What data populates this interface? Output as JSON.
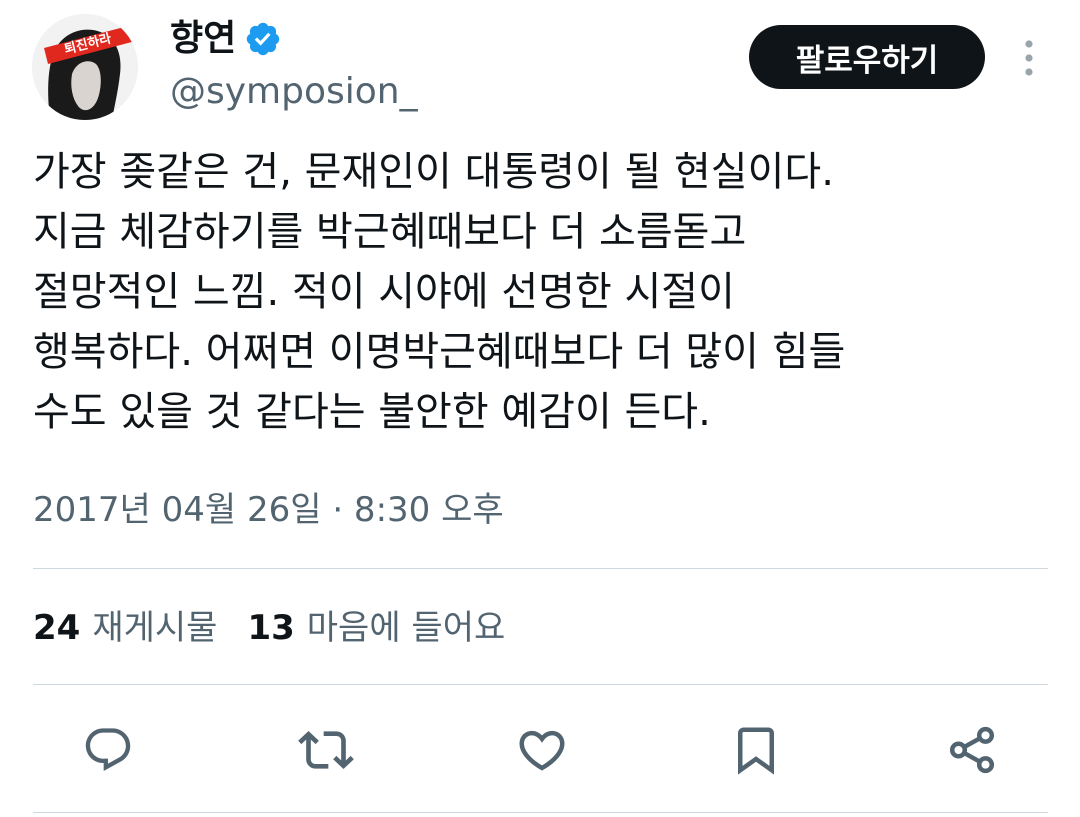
{
  "author": {
    "display_name": "향연",
    "handle": "@symposion_",
    "verified": true,
    "avatar_headband_text": "퇴진하라"
  },
  "follow_label": "팔로우하기",
  "tweet": {
    "lines": [
      "가장 좆같은 건, 문재인이 대통령이 될 현실이다.",
      "지금 체감하기를 박근혜때보다 더 소름돋고",
      "절망적인 느낌. 적이 시야에 선명한 시절이",
      "행복하다. 어쩌면 이명박근혜때보다 더 많이 힘들",
      "수도 있을 것 같다는 불안한 예감이 든다."
    ],
    "timestamp": "2017년 04월 26일 · 8:30 오후"
  },
  "stats": {
    "reposts_count": "24",
    "reposts_label": "재게시물",
    "likes_count": "13",
    "likes_label": "마음에 들어요"
  },
  "actions": [
    "reply-icon",
    "repost-icon",
    "like-icon",
    "bookmark-icon",
    "share-icon"
  ],
  "colors": {
    "text_primary": "#0f1419",
    "text_secondary": "#536471",
    "verified_blue": "#1d9bf0",
    "divider": "#cfd9de",
    "follow_button_bg": "#0f1419",
    "headband_red": "#e0281e"
  }
}
